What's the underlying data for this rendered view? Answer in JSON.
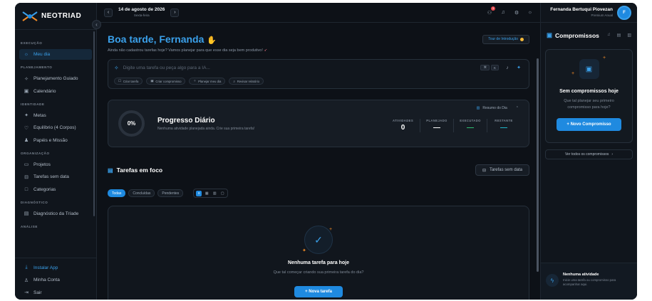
{
  "app": {
    "brand": "NEOTRIAD"
  },
  "sidebar": {
    "sections": [
      {
        "title": "EXECUÇÃO",
        "items": [
          {
            "label": "Meu dia",
            "icon": "sun-icon",
            "active": true
          }
        ]
      },
      {
        "title": "PLANEJAMENTO",
        "items": [
          {
            "label": "Planejamento Guiado",
            "icon": "sparkles-icon"
          },
          {
            "label": "Calendário",
            "icon": "calendar-icon"
          }
        ]
      },
      {
        "title": "IDENTIDADE",
        "items": [
          {
            "label": "Metas",
            "icon": "target-icon"
          },
          {
            "label": "Equilíbrio (4 Corpos)",
            "icon": "heart-icon"
          },
          {
            "label": "Papéis e Missão",
            "icon": "users-icon"
          }
        ]
      },
      {
        "title": "ORGANIZAÇÃO",
        "items": [
          {
            "label": "Projetos",
            "icon": "folder-icon"
          },
          {
            "label": "Tarefas sem data",
            "icon": "inbox-icon"
          },
          {
            "label": "Categorias",
            "icon": "square-icon"
          }
        ]
      },
      {
        "title": "DIAGNÓSTICO",
        "items": [
          {
            "label": "Diagnóstico da Tríade",
            "icon": "clipboard-icon"
          }
        ]
      },
      {
        "title": "ANÁLISE",
        "items": []
      }
    ],
    "bottom": [
      {
        "label": "Instalar App",
        "icon": "download-icon"
      },
      {
        "label": "Minha Conta",
        "icon": "user-icon"
      },
      {
        "label": "Sair",
        "icon": "logout-icon"
      }
    ]
  },
  "topbar": {
    "date": "14 de agosto de 2026",
    "weekday": "Sexta-feira",
    "notif_count": "3"
  },
  "greeting": {
    "prefix": "Boa tarde, ",
    "name": "Fernanda",
    "subtitle": "Ainda não cadastrou tarefas hoje? Vamos planejar para que esse dia seja bem produtivo!",
    "tour_label": "Tour de Introdução"
  },
  "ai": {
    "placeholder": "Digite uma tarefa ou peça algo para a IA...",
    "kbd1": "⌘",
    "kbd2": "K",
    "chips": [
      "Criar tarefa",
      "Criar compromisso",
      "Planejar meu dia",
      "Revisar relatório"
    ]
  },
  "progress": {
    "percent_label": "0%",
    "title": "Progresso Diário",
    "subtitle": "Nenhuma atividade planejada ainda. Crie sua primeira tarefa!",
    "summary_label": "Resumo do Dia",
    "stats": [
      {
        "label": "ATIVIDADES",
        "value": "0"
      },
      {
        "label": "PLANEJADO",
        "value": "—"
      },
      {
        "label": "EXECUTADO",
        "value": "—"
      },
      {
        "label": "RESTANTE",
        "value": "—"
      }
    ]
  },
  "focus": {
    "title": "Tarefas em foco",
    "no_date_label": "Tarefas sem data",
    "filters": [
      "Todas",
      "Concluídas",
      "Pendentes"
    ],
    "empty_title": "Nenhuma tarefa para hoje",
    "empty_sub": "Que tal começar criando sua primeira tarefa do dia?",
    "new_task_label": "+ Nova tarefa"
  },
  "user": {
    "name": "Fernanda Bertuqui Piovezan",
    "role": "Premium Anual",
    "initial": "F"
  },
  "commitments": {
    "title": "Compromissos",
    "empty_title": "Sem compromissos hoje",
    "empty_sub": "Que tal planejar seu primeiro compromisso para hoje?",
    "new_label": "+ Novo Compromisso",
    "see_all": "Ver todos os compromissos"
  },
  "activity": {
    "title": "Nenhuma atividade",
    "subtitle": "Inicie uma tarefa ou compromisso para acompanhar aqui."
  },
  "colors": {
    "accent": "#1f8ae0",
    "accent_text": "#3aa0ea",
    "bg": "#0d1117",
    "executed": "#2fbf71",
    "remaining": "#1fb5c9"
  }
}
